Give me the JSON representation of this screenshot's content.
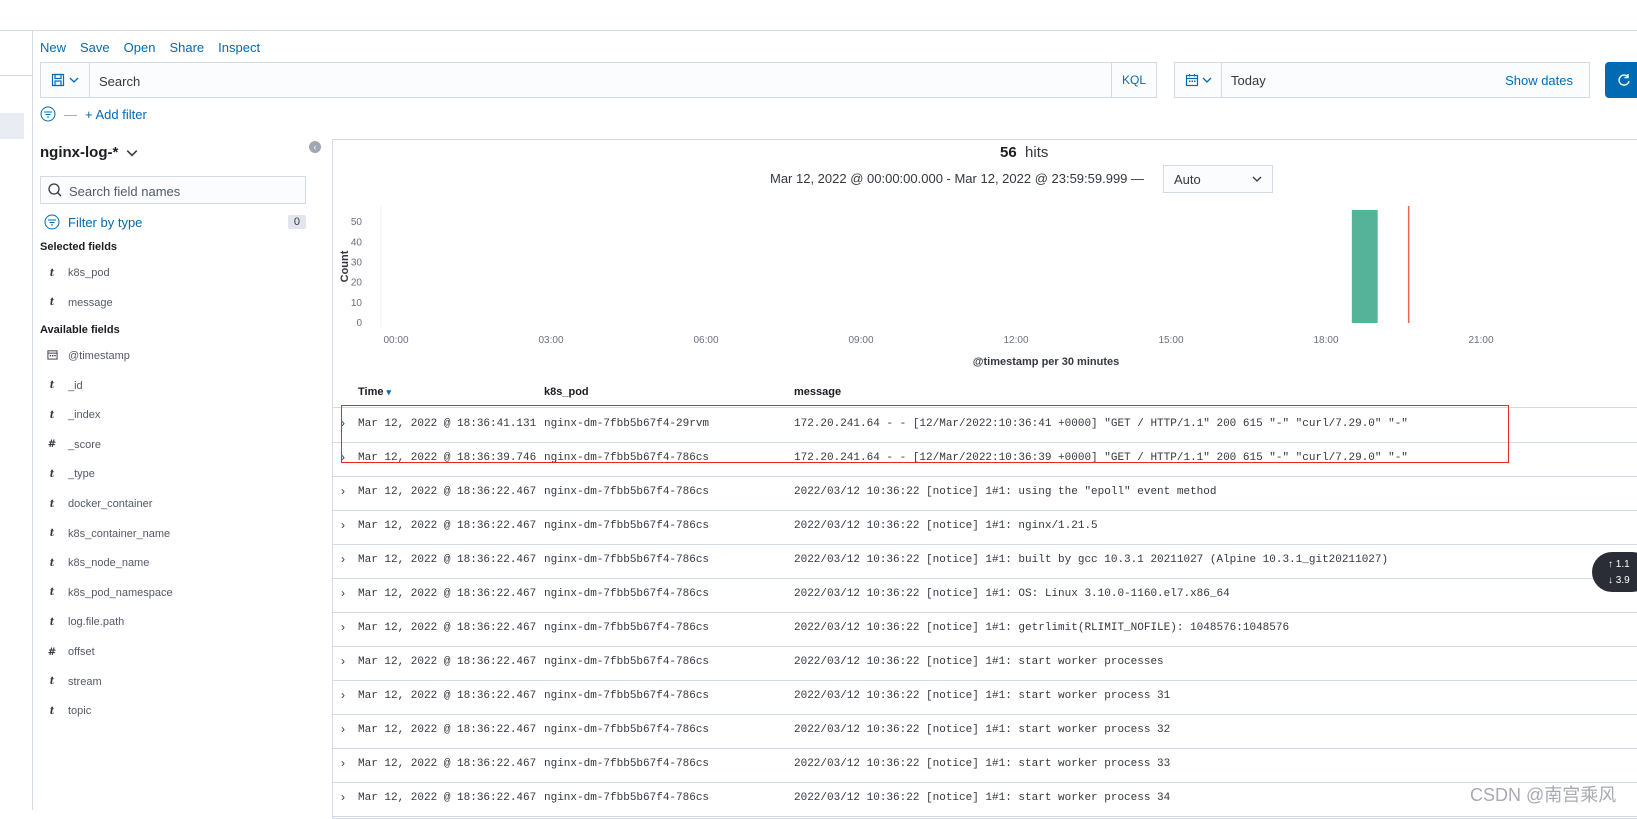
{
  "menu": {
    "items": [
      "New",
      "Save",
      "Open",
      "Share",
      "Inspect"
    ]
  },
  "query": {
    "placeholder": "Search",
    "language": "KQL"
  },
  "date": {
    "value": "Today",
    "show_dates": "Show dates"
  },
  "filter": {
    "add_label": "+ Add filter"
  },
  "sidebar": {
    "index_pattern": "nginx-log-*",
    "search_placeholder": "Search field names",
    "filter_by_type": "Filter by type",
    "filter_count": "0",
    "selected_title": "Selected fields",
    "selected_fields": [
      {
        "type": "t",
        "name": "k8s_pod"
      },
      {
        "type": "t",
        "name": "message"
      }
    ],
    "available_title": "Available fields",
    "available_fields": [
      {
        "type": "date",
        "name": "@timestamp"
      },
      {
        "type": "t",
        "name": "_id"
      },
      {
        "type": "t",
        "name": "_index"
      },
      {
        "type": "#",
        "name": "_score"
      },
      {
        "type": "t",
        "name": "_type"
      },
      {
        "type": "t",
        "name": "docker_container"
      },
      {
        "type": "t",
        "name": "k8s_container_name"
      },
      {
        "type": "t",
        "name": "k8s_node_name"
      },
      {
        "type": "t",
        "name": "k8s_pod_namespace"
      },
      {
        "type": "t",
        "name": "log.file.path"
      },
      {
        "type": "#",
        "name": "offset"
      },
      {
        "type": "t",
        "name": "stream"
      },
      {
        "type": "t",
        "name": "topic"
      }
    ]
  },
  "summary": {
    "hits_count": "56",
    "hits_label": "hits",
    "range": "Mar 12, 2022 @ 00:00:00.000 - Mar 12, 2022 @ 23:59:59.999 —",
    "interval": "Auto"
  },
  "chart_data": {
    "type": "bar",
    "xlabel": "@timestamp per 30 minutes",
    "ylabel": "Count",
    "x_ticks": [
      "00:00",
      "03:00",
      "06:00",
      "09:00",
      "12:00",
      "15:00",
      "18:00",
      "21:00"
    ],
    "y_ticks": [
      0,
      10,
      20,
      30,
      40,
      50
    ],
    "ylim": [
      0,
      56
    ],
    "xlim_hours": [
      0,
      24
    ],
    "bars": [
      {
        "start_hour": 18.5,
        "end_hour": 19.0,
        "value": 56
      }
    ],
    "now_marker_hour": 19.6,
    "colors": {
      "bar": "#54b399",
      "now": "#e7664c"
    }
  },
  "table": {
    "columns": {
      "time": "Time",
      "pod": "k8s_pod",
      "message": "message"
    },
    "rows": [
      {
        "time": "Mar 12, 2022 @ 18:36:41.131",
        "pod": "nginx-dm-7fbb5b67f4-29rvm",
        "message": "172.20.241.64 - - [12/Mar/2022:10:36:41 +0000] \"GET / HTTP/1.1\" 200 615 \"-\" \"curl/7.29.0\" \"-\""
      },
      {
        "time": "Mar 12, 2022 @ 18:36:39.746",
        "pod": "nginx-dm-7fbb5b67f4-786cs",
        "message": "172.20.241.64 - - [12/Mar/2022:10:36:39 +0000] \"GET / HTTP/1.1\" 200 615 \"-\" \"curl/7.29.0\" \"-\""
      },
      {
        "time": "Mar 12, 2022 @ 18:36:22.467",
        "pod": "nginx-dm-7fbb5b67f4-786cs",
        "message": "2022/03/12 10:36:22 [notice] 1#1: using the \"epoll\" event method"
      },
      {
        "time": "Mar 12, 2022 @ 18:36:22.467",
        "pod": "nginx-dm-7fbb5b67f4-786cs",
        "message": "2022/03/12 10:36:22 [notice] 1#1: nginx/1.21.5"
      },
      {
        "time": "Mar 12, 2022 @ 18:36:22.467",
        "pod": "nginx-dm-7fbb5b67f4-786cs",
        "message": "2022/03/12 10:36:22 [notice] 1#1: built by gcc 10.3.1 20211027 (Alpine 10.3.1_git20211027)"
      },
      {
        "time": "Mar 12, 2022 @ 18:36:22.467",
        "pod": "nginx-dm-7fbb5b67f4-786cs",
        "message": "2022/03/12 10:36:22 [notice] 1#1: OS: Linux 3.10.0-1160.el7.x86_64"
      },
      {
        "time": "Mar 12, 2022 @ 18:36:22.467",
        "pod": "nginx-dm-7fbb5b67f4-786cs",
        "message": "2022/03/12 10:36:22 [notice] 1#1: getrlimit(RLIMIT_NOFILE): 1048576:1048576"
      },
      {
        "time": "Mar 12, 2022 @ 18:36:22.467",
        "pod": "nginx-dm-7fbb5b67f4-786cs",
        "message": "2022/03/12 10:36:22 [notice] 1#1: start worker processes"
      },
      {
        "time": "Mar 12, 2022 @ 18:36:22.467",
        "pod": "nginx-dm-7fbb5b67f4-786cs",
        "message": "2022/03/12 10:36:22 [notice] 1#1: start worker process 31"
      },
      {
        "time": "Mar 12, 2022 @ 18:36:22.467",
        "pod": "nginx-dm-7fbb5b67f4-786cs",
        "message": "2022/03/12 10:36:22 [notice] 1#1: start worker process 32"
      },
      {
        "time": "Mar 12, 2022 @ 18:36:22.467",
        "pod": "nginx-dm-7fbb5b67f4-786cs",
        "message": "2022/03/12 10:36:22 [notice] 1#1: start worker process 33"
      },
      {
        "time": "Mar 12, 2022 @ 18:36:22.467",
        "pod": "nginx-dm-7fbb5b67f4-786cs",
        "message": "2022/03/12 10:36:22 [notice] 1#1: start worker process 34"
      }
    ]
  },
  "network_widget": {
    "up": "1.1",
    "down": "3.9"
  },
  "watermark": "CSDN @南宫乘风"
}
